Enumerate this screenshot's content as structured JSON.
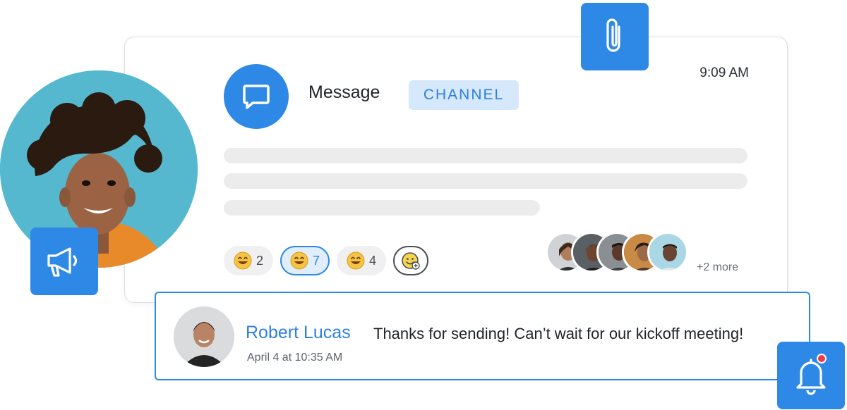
{
  "message_card": {
    "title": "Message",
    "badge": "CHANNEL",
    "time": "9:09 AM",
    "reactions": [
      {
        "emoji": "grinning-face",
        "count": "2",
        "active": false
      },
      {
        "emoji": "grinning-face",
        "count": "7",
        "active": true
      },
      {
        "emoji": "grinning-face",
        "count": "4",
        "active": false
      }
    ],
    "add_reaction_icon": "add-emoji-icon",
    "participants_more": "+2 more"
  },
  "reply": {
    "author": "Robert Lucas",
    "text": "Thanks for sending! Can’t wait for our kickoff meeting!",
    "date": "April 4 at 10:35 AM"
  },
  "icons": {
    "message": "chat-bubble-icon",
    "attachment": "paperclip-icon",
    "announcement": "megaphone-icon",
    "notification": "bell-icon"
  },
  "colors": {
    "accent": "#2d88e6",
    "badge_bg": "#d6e8fb",
    "notification_dot": "#ef3a4a",
    "reply_border": "#2d88e6"
  }
}
